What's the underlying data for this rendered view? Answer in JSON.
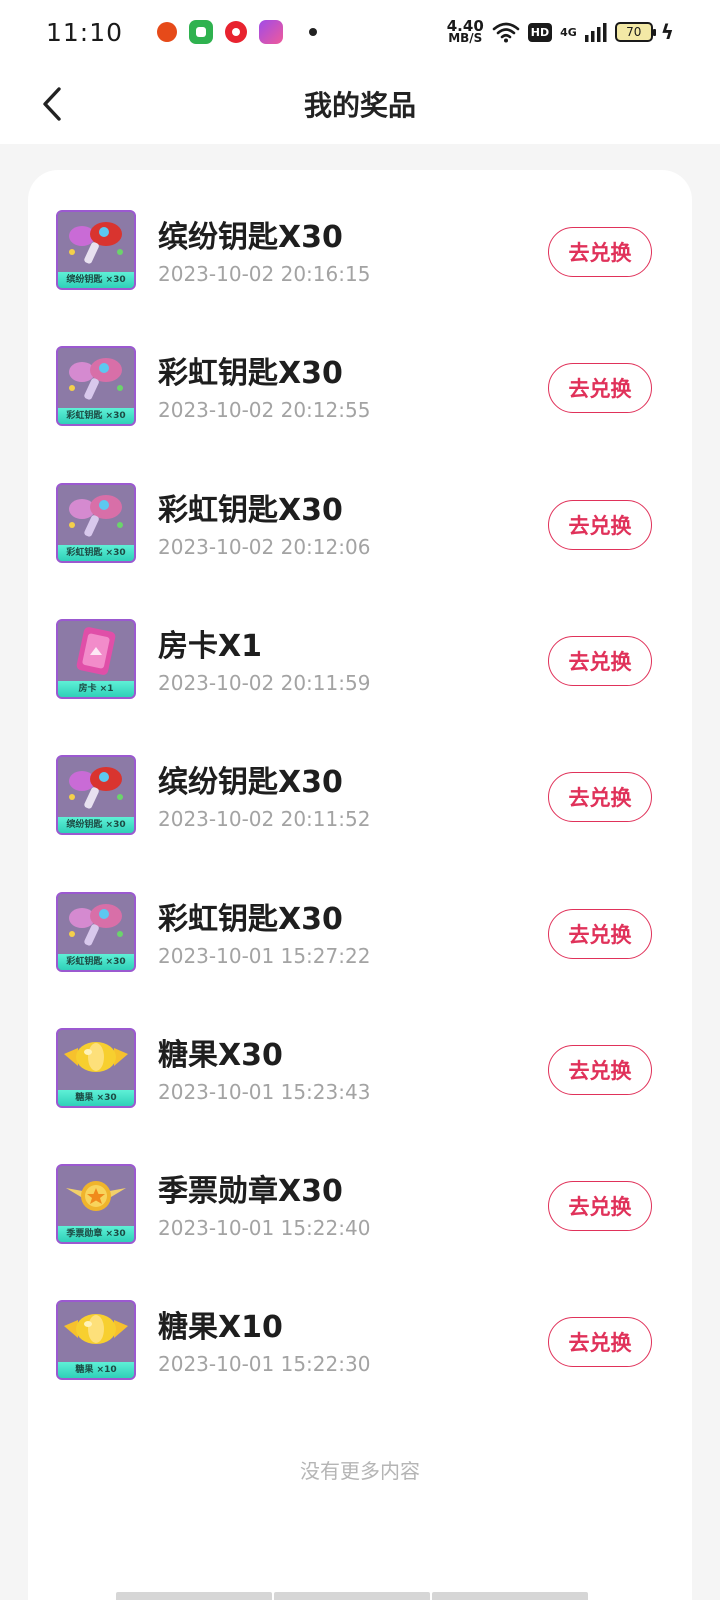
{
  "status_bar": {
    "time": "11:10",
    "net_speed_value": "4.40",
    "net_speed_unit": "MB/S",
    "hd_label": "HD",
    "signal_label": "4G",
    "battery_level": "70"
  },
  "header": {
    "title": "我的奖品"
  },
  "prizes": [
    {
      "name": "缤纷钥匙X30",
      "time": "2023-10-02 20:16:15",
      "thumb_label": "缤纷钥匙 ×30",
      "kind": "key-red",
      "button": "去兑换"
    },
    {
      "name": "彩虹钥匙X30",
      "time": "2023-10-02 20:12:55",
      "thumb_label": "彩虹钥匙 ×30",
      "kind": "key-pink",
      "button": "去兑换"
    },
    {
      "name": "彩虹钥匙X30",
      "time": "2023-10-02 20:12:06",
      "thumb_label": "彩虹钥匙 ×30",
      "kind": "key-pink",
      "button": "去兑换"
    },
    {
      "name": "房卡X1",
      "time": "2023-10-02 20:11:59",
      "thumb_label": "房卡 ×1",
      "kind": "room-card",
      "button": "去兑换"
    },
    {
      "name": "缤纷钥匙X30",
      "time": "2023-10-02 20:11:52",
      "thumb_label": "缤纷钥匙 ×30",
      "kind": "key-red",
      "button": "去兑换"
    },
    {
      "name": "彩虹钥匙X30",
      "time": "2023-10-01 15:27:22",
      "thumb_label": "彩虹钥匙 ×30",
      "kind": "key-pink",
      "button": "去兑换"
    },
    {
      "name": "糖果X30",
      "time": "2023-10-01 15:23:43",
      "thumb_label": "糖果 ×30",
      "kind": "candy",
      "button": "去兑换"
    },
    {
      "name": "季票勋章X30",
      "time": "2023-10-01 15:22:40",
      "thumb_label": "季票勋章 ×30",
      "kind": "medal",
      "button": "去兑换"
    },
    {
      "name": "糖果X10",
      "time": "2023-10-01 15:22:30",
      "thumb_label": "糖果 ×10",
      "kind": "candy",
      "button": "去兑换"
    }
  ],
  "footer": {
    "no_more": "没有更多内容"
  },
  "colors": {
    "accent": "#e0325a",
    "thumb_border": "#9b59d0",
    "thumb_label_bg": "#2fd0b8"
  }
}
